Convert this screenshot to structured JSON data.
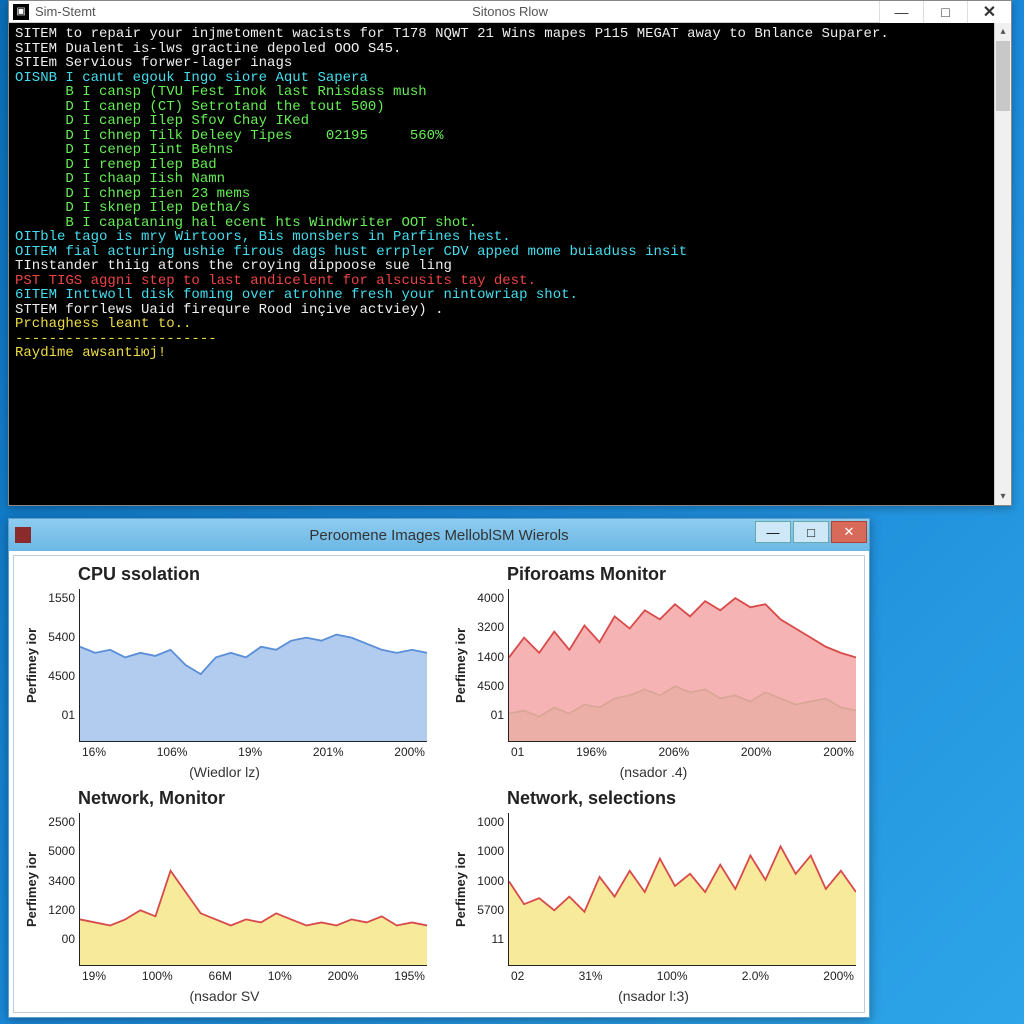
{
  "terminal": {
    "app_name": "Sim-Stemt",
    "title": "Sitonos Rlow",
    "lines": [
      {
        "class": "c-white",
        "text": "SITEM to repair your injmetoment wacists for T178 NQWT 21 Wins mapes P115 MEGAT away to Bnlance Suparer."
      },
      {
        "class": "",
        "text": ""
      },
      {
        "class": "c-white",
        "text": "SITEM Dualent is-lws gractine depoled OOO S45."
      },
      {
        "class": "",
        "text": ""
      },
      {
        "class": "c-white",
        "text": "STIEm Servious forwer-lager inags"
      },
      {
        "class": "",
        "text": ""
      },
      {
        "class": "c-cyan",
        "text": "OISNB I canut egouk Ingo siore Aqut Sapera"
      },
      {
        "class": "c-green",
        "text": "      B I cansp (TVU Fest Inok last Rnisdass mush"
      },
      {
        "class": "c-green",
        "text": "      D I canep (CT) Setrotand the tout 500)"
      },
      {
        "class": "c-green",
        "text": "      D I canep Ilep Sfov Chay IKed"
      },
      {
        "class": "c-green",
        "text": "      D I chnep Tilk Deleey Tipes    02195     560%"
      },
      {
        "class": "c-green",
        "text": "      D I cenep Iint Behns"
      },
      {
        "class": "c-green",
        "text": "      D I renep Ilep Bad"
      },
      {
        "class": "c-green",
        "text": "      D I chaap Iish Namn"
      },
      {
        "class": "c-green",
        "text": "      D I chnep Iien 23 mems"
      },
      {
        "class": "c-green",
        "text": "      D I sknep Ilep Detha/s"
      },
      {
        "class": "c-green",
        "text": "      B I capataning hal ecent hts Windwriter OOT shot."
      },
      {
        "class": "",
        "text": ""
      },
      {
        "class": "c-cyan",
        "text": "OITble tago is mry Wirtoors, Bis monsbers in Parfines hest."
      },
      {
        "class": "",
        "text": ""
      },
      {
        "class": "c-cyan",
        "text": "OITEM fial acturing ushie firous dags hust errpler CDV apped mome buiaduss insit"
      },
      {
        "class": "c-white",
        "text": "TInstander thiig atons the croying dippoose sue ling"
      },
      {
        "class": "",
        "text": ""
      },
      {
        "class": "c-red",
        "text": "PST TIGS aggni step to last andicelent for alscusits tay dest."
      },
      {
        "class": "",
        "text": ""
      },
      {
        "class": "c-cyan",
        "text": "6ITEM Inttwoll disk foming over atrohne fresh your nintowriap shot."
      },
      {
        "class": "",
        "text": ""
      },
      {
        "class": "c-white",
        "text": "STTEM forrlews Uaid firequre Rood inçive actviey) ."
      },
      {
        "class": "",
        "text": ""
      },
      {
        "class": "c-yellow",
        "text": "Prchaghess leant to.."
      },
      {
        "class": "c-yellow",
        "text": "------------------------"
      },
      {
        "class": "c-yellow",
        "text": "Raydime awsantiюj!"
      }
    ]
  },
  "perf": {
    "title": "Peroomene Images MelloblSM Wierols"
  },
  "chart_data": [
    {
      "type": "area",
      "title": "CPU ssolation",
      "ylabel": "Perfimey ior",
      "xlabel": "(Wiedlor lz)",
      "y_ticks": [
        "1550",
        "5400",
        "4500",
        "01"
      ],
      "x_ticks": [
        "16%",
        "106%",
        "19%",
        "201%",
        "200%"
      ],
      "series": [
        {
          "name": "cpu",
          "color": "#5a8ed8",
          "fill": "#a3c3eb",
          "values": [
            62,
            58,
            60,
            55,
            58,
            56,
            60,
            50,
            44,
            55,
            58,
            55,
            62,
            60,
            66,
            68,
            66,
            70,
            68,
            64,
            60,
            58,
            60,
            58
          ]
        }
      ],
      "ylim": [
        0,
        100
      ]
    },
    {
      "type": "area",
      "title": "Piforoams Monitor",
      "ylabel": "Perfimey ior",
      "xlabel": "(nsador .4)",
      "y_ticks": [
        "4000",
        "3200",
        "1400",
        "4500",
        "01"
      ],
      "x_ticks": [
        "01",
        "196%",
        "206%",
        "200%",
        "200%"
      ],
      "series": [
        {
          "name": "red",
          "color": "#d84a4a",
          "fill": "#f4a6a6",
          "values": [
            55,
            68,
            58,
            72,
            60,
            76,
            65,
            82,
            74,
            86,
            80,
            90,
            82,
            92,
            86,
            94,
            88,
            90,
            80,
            74,
            68,
            62,
            58,
            55
          ]
        },
        {
          "name": "green",
          "color": "#4aa84a",
          "fill": "#a6e0a6",
          "values": [
            18,
            20,
            16,
            22,
            18,
            24,
            22,
            28,
            30,
            34,
            30,
            36,
            32,
            34,
            28,
            30,
            26,
            32,
            28,
            24,
            26,
            28,
            22,
            20
          ]
        }
      ],
      "ylim": [
        0,
        100
      ]
    },
    {
      "type": "line",
      "title": "Network, Monitor",
      "ylabel": "Perfimey ior",
      "xlabel": "(nsador SV",
      "y_ticks": [
        "2500",
        "5000",
        "3400",
        "1200",
        "00"
      ],
      "x_ticks": [
        "19%",
        "100%",
        "66M",
        "10%",
        "200%",
        "195%"
      ],
      "series": [
        {
          "name": "net",
          "color": "#d84a4a",
          "fill": "#f7e68a",
          "values": [
            30,
            28,
            26,
            30,
            36,
            32,
            62,
            48,
            34,
            30,
            26,
            30,
            28,
            34,
            30,
            26,
            28,
            26,
            30,
            28,
            32,
            26,
            28,
            26
          ]
        }
      ],
      "ylim": [
        0,
        100
      ]
    },
    {
      "type": "line",
      "title": "Network, selections",
      "ylabel": "Perfimey ior",
      "xlabel": "(nsador l:3)",
      "y_ticks": [
        "1000",
        "1000",
        "1000",
        "5700",
        "11"
      ],
      "x_ticks": [
        "02",
        "31%",
        "100%",
        "2.0%",
        "200%"
      ],
      "series": [
        {
          "name": "sel",
          "color": "#d84a4a",
          "fill": "#f7e68a",
          "values": [
            55,
            40,
            44,
            36,
            45,
            35,
            58,
            45,
            62,
            48,
            70,
            52,
            60,
            48,
            66,
            50,
            72,
            56,
            78,
            60,
            72,
            50,
            62,
            48
          ]
        }
      ],
      "ylim": [
        0,
        100
      ]
    }
  ]
}
